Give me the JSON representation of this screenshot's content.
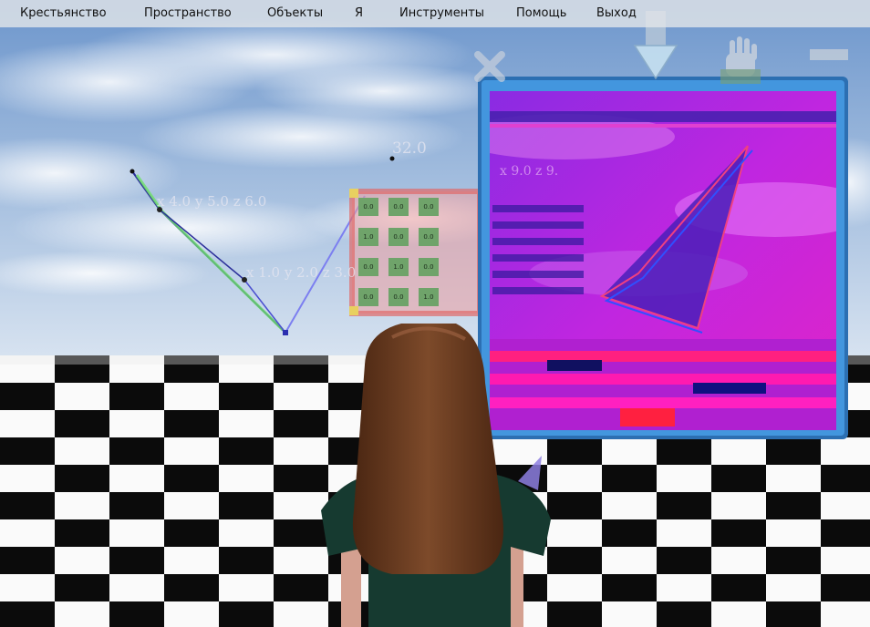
{
  "menu": [
    {
      "label": "Крестьянство"
    },
    {
      "label": "Пространство"
    },
    {
      "label": "Объекты"
    },
    {
      "label": "Я"
    },
    {
      "label": "Инструменты"
    },
    {
      "label": "Помощь"
    },
    {
      "label": "Выход"
    }
  ],
  "labels": {
    "point_a": "x 4.0 y 5.0 z 6.0",
    "point_b": "x 1.0 y 2.0 z 3.0",
    "value": "32.0",
    "screen_point": "x 9.0 z 9."
  },
  "matrix": [
    [
      "0.0",
      "0.0",
      "0.0"
    ],
    [
      "1.0",
      "0.0",
      "0.0"
    ],
    [
      "0.0",
      "1.0",
      "0.0"
    ],
    [
      "0.0",
      "0.0",
      "1.0"
    ]
  ],
  "icons": [
    "close-x-icon",
    "down-arrow-icon",
    "hand-icon",
    "minimize-icon"
  ],
  "colors": {
    "sky": "#7fa6d6",
    "screen_frame": "#3c8ed8",
    "screen_fill": "#b23be8",
    "hair": "#6b3c22",
    "shirt": "#163a30"
  }
}
